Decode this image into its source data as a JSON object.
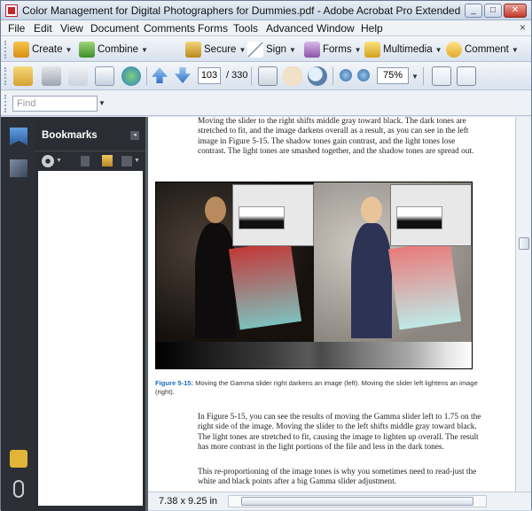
{
  "window": {
    "title": "Color Management for Digital Photographers for Dummies.pdf - Adobe Acrobat Pro Extended",
    "controls": {
      "minimize": "_",
      "maximize": "□",
      "close": "✕"
    }
  },
  "menu": [
    "File",
    "Edit",
    "View",
    "Document",
    "Comments",
    "Forms",
    "Tools",
    "Advanced",
    "Window",
    "Help"
  ],
  "menu_close": "×",
  "toolbar_tasks": {
    "create": "Create",
    "combine": "Combine",
    "secure": "Secure",
    "sign": "Sign",
    "forms": "Forms",
    "multimedia": "Multimedia",
    "comment": "Comment"
  },
  "navigation": {
    "current_page": "103",
    "page_separator": "/",
    "total_pages": "330",
    "zoom": "75%"
  },
  "find": {
    "placeholder": "Find"
  },
  "bookmarks": {
    "title": "Bookmarks",
    "collapse": "◂"
  },
  "document": {
    "para1": "Moving the slider to the right shifts middle gray toward black. The dark tones are stretched to fit, and the image darkens overall as a result, as you can see in the left image in Figure 5-15. The shadow tones gain contrast, and the light tones lose contrast. The light tones are smashed together, and the shadow tones are spread out.",
    "caption_ref": "Figure 5-15:",
    "caption_text": " Moving the Gamma slider right darkens an image (left). Moving the slider left lightens an image (right).",
    "para2": "In Figure 5-15, you can see the results of moving the Gamma slider left to 1.75 on the right side of the image. Moving the slider to the left shifts middle gray toward black. The light tones are stretched to fit, causing the image to lighten up overall. The result has more contrast in the light portions of the file and less in the dark tones.",
    "para3": "This re-proportioning of the image tones is why you sometimes need to read-just the white and black points after a big Gamma slider adjustment."
  },
  "status": {
    "page_size": "7.38 x 9.25 in"
  }
}
